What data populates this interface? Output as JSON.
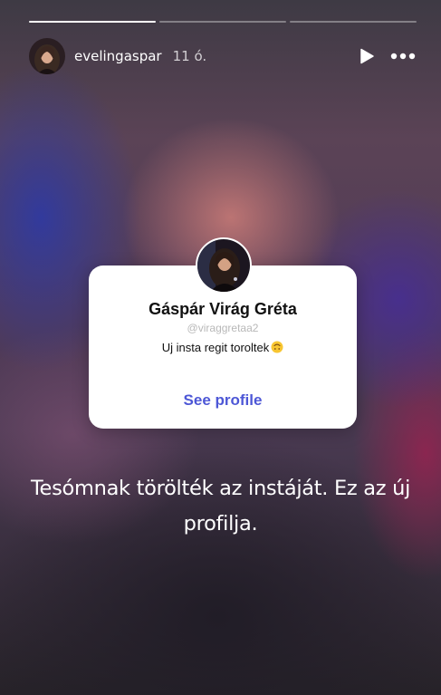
{
  "story": {
    "progress": [
      1,
      0,
      0
    ],
    "username": "evelingaspar",
    "time": "11 ó.",
    "icons": {
      "play": "play-icon",
      "more": "more-dots-icon"
    }
  },
  "profile_card": {
    "name": "Gáspár Virág Gréta",
    "handle": "@viraggretaa2",
    "bio": "Uj insta regit toroltek",
    "bio_emoji": "upside-down-face-emoji",
    "link_label": "See profile",
    "link_color": "#4d57d6"
  },
  "caption": "Tesómnak törölték az instáját. Ez az új profilja.",
  "colors": {
    "text_primary": "#ffffff",
    "card_background": "#ffffff"
  }
}
